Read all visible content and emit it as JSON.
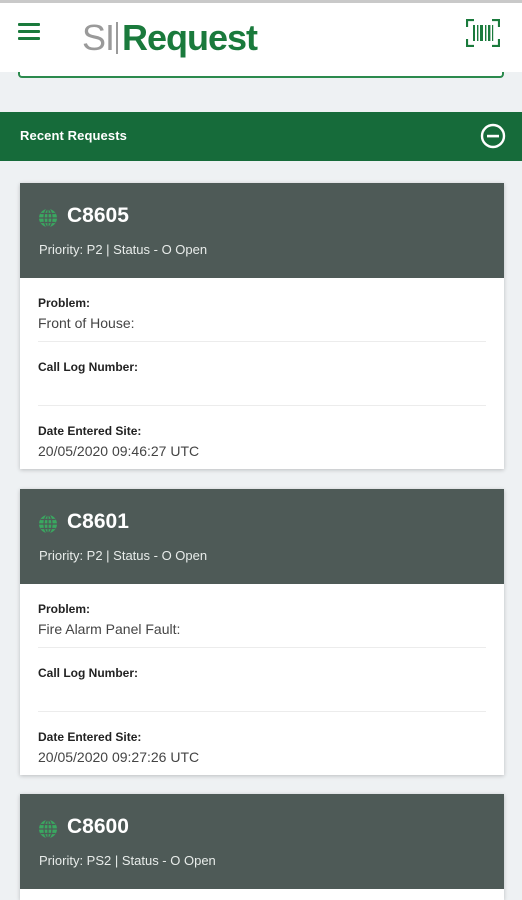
{
  "app": {
    "logo_prefix": "SI",
    "logo_main": "Request",
    "brand_color": "#1a7a3c",
    "menu_icon": "hamburger-menu-icon",
    "scan_icon": "barcode-scan-icon"
  },
  "recent": {
    "title": "Recent Requests",
    "collapse_icon": "minus-circle-icon"
  },
  "labels": {
    "problem": "Problem:",
    "call_log": "Call Log Number:",
    "date_entered": "Date Entered Site:"
  },
  "requests": [
    {
      "ref": "C8605",
      "meta": "Priority: P2  |  Status - O Open",
      "problem": "Front of House:",
      "call_log": "",
      "date_entered": "20/05/2020 09:46:27 UTC"
    },
    {
      "ref": "C8601",
      "meta": "Priority: P2  |  Status - O Open",
      "problem": "Fire Alarm Panel Fault:",
      "call_log": "",
      "date_entered": "20/05/2020 09:27:26 UTC"
    },
    {
      "ref": "C8600",
      "meta": "Priority: PS2  |  Status - O Open"
    }
  ]
}
